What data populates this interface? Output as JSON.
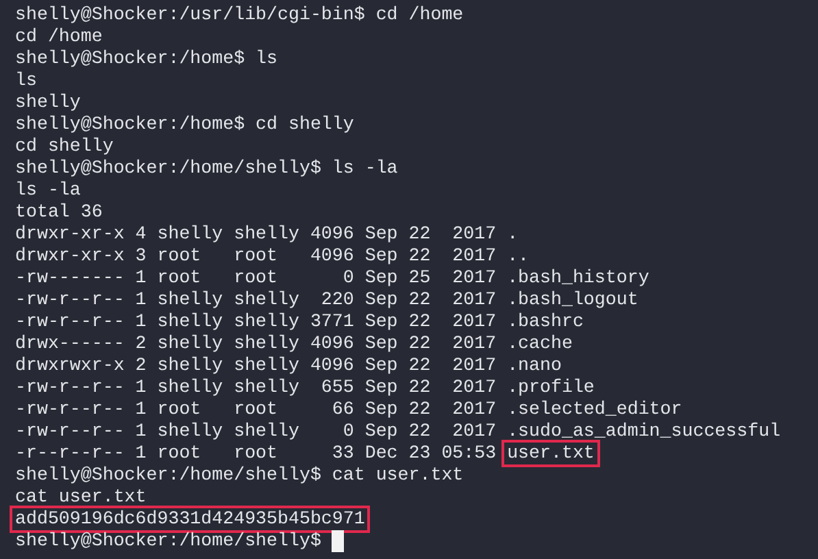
{
  "terminal": {
    "lines": [
      {
        "segments": [
          {
            "text": "shelly@Shocker:/usr/lib/cgi-bin$ cd /home",
            "highlighted": false
          }
        ]
      },
      {
        "segments": [
          {
            "text": "cd /home",
            "highlighted": false
          }
        ]
      },
      {
        "segments": [
          {
            "text": "shelly@Shocker:/home$ ls",
            "highlighted": false
          }
        ]
      },
      {
        "segments": [
          {
            "text": "ls",
            "highlighted": false
          }
        ]
      },
      {
        "segments": [
          {
            "text": "shelly",
            "highlighted": false
          }
        ]
      },
      {
        "segments": [
          {
            "text": "shelly@Shocker:/home$ cd shelly",
            "highlighted": false
          }
        ]
      },
      {
        "segments": [
          {
            "text": "cd shelly",
            "highlighted": false
          }
        ]
      },
      {
        "segments": [
          {
            "text": "shelly@Shocker:/home/shelly$ ls -la",
            "highlighted": false
          }
        ]
      },
      {
        "segments": [
          {
            "text": "ls -la",
            "highlighted": false
          }
        ]
      },
      {
        "segments": [
          {
            "text": "total 36",
            "highlighted": false
          }
        ]
      },
      {
        "segments": [
          {
            "text": "drwxr-xr-x 4 shelly shelly 4096 Sep 22  2017 .",
            "highlighted": false
          }
        ]
      },
      {
        "segments": [
          {
            "text": "drwxr-xr-x 3 root   root   4096 Sep 22  2017 ..",
            "highlighted": false
          }
        ]
      },
      {
        "segments": [
          {
            "text": "-rw------- 1 root   root      0 Sep 25  2017 .bash_history",
            "highlighted": false
          }
        ]
      },
      {
        "segments": [
          {
            "text": "-rw-r--r-- 1 shelly shelly  220 Sep 22  2017 .bash_logout",
            "highlighted": false
          }
        ]
      },
      {
        "segments": [
          {
            "text": "-rw-r--r-- 1 shelly shelly 3771 Sep 22  2017 .bashrc",
            "highlighted": false
          }
        ]
      },
      {
        "segments": [
          {
            "text": "drwx------ 2 shelly shelly 4096 Sep 22  2017 .cache",
            "highlighted": false
          }
        ]
      },
      {
        "segments": [
          {
            "text": "drwxrwxr-x 2 shelly shelly 4096 Sep 22  2017 .nano",
            "highlighted": false
          }
        ]
      },
      {
        "segments": [
          {
            "text": "-rw-r--r-- 1 shelly shelly  655 Sep 22  2017 .profile",
            "highlighted": false
          }
        ]
      },
      {
        "segments": [
          {
            "text": "-rw-r--r-- 1 root   root     66 Sep 22  2017 .selected_editor",
            "highlighted": false
          }
        ]
      },
      {
        "segments": [
          {
            "text": "-rw-r--r-- 1 shelly shelly    0 Sep 22  2017 .sudo_as_admin_successful",
            "highlighted": false
          }
        ]
      },
      {
        "segments": [
          {
            "text": "-r--r--r-- 1 root   root     33 Dec 23 05:53 ",
            "highlighted": false
          },
          {
            "text": "user.txt",
            "highlighted": true
          }
        ]
      },
      {
        "segments": [
          {
            "text": "shelly@Shocker:/home/shelly$ cat user.txt",
            "highlighted": false
          }
        ]
      },
      {
        "segments": [
          {
            "text": "cat user.txt",
            "highlighted": false
          }
        ]
      },
      {
        "segments": [
          {
            "text": "add509196dc6d9331d424935b45bc971",
            "highlighted": true
          }
        ]
      },
      {
        "segments": [
          {
            "text": "shelly@Shocker:/home/shelly$ ",
            "highlighted": false
          }
        ],
        "cursor": true
      }
    ]
  }
}
